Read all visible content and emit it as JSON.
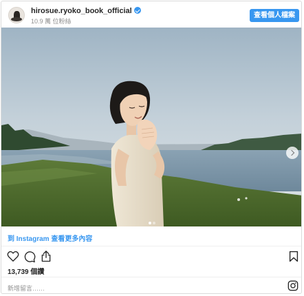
{
  "header": {
    "username": "hirosue.ryoko_book_official",
    "followers": "10.9 萬 位粉絲",
    "view_profile_label": "查看個人檔案"
  },
  "post": {
    "image_alt": "A short-haired woman in a white sleeveless dress smiles with hands clasped beside a lake under a pale sky",
    "carousel_dots": 2,
    "active_dot": 1
  },
  "links": {
    "more_on_instagram": "到 Instagram 查看更多內容"
  },
  "actions": {
    "likes": "13,739 個讚",
    "comment_placeholder": "新增留言……"
  },
  "icons": {
    "like": "heart-icon",
    "comment": "comment-icon",
    "share": "share-icon",
    "save": "bookmark-icon",
    "instagram": "instagram-icon",
    "verified": "verified-badge-icon",
    "next": "chevron-right-icon"
  },
  "colors": {
    "accent": "#3897f0",
    "text": "#262626",
    "muted": "#8e8e8e",
    "border": "#dbdbdb"
  }
}
